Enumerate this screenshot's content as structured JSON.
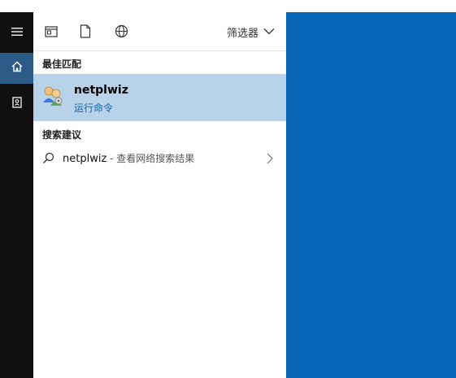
{
  "toolbar": {
    "filter_label": "筛选器",
    "icons": [
      "app-icon",
      "document-icon",
      "web-icon"
    ]
  },
  "rail": {
    "items": [
      {
        "icon": "menu-icon"
      },
      {
        "icon": "home-icon",
        "active": true
      },
      {
        "icon": "notebook-icon"
      }
    ]
  },
  "best_match": {
    "header": "最佳匹配",
    "title": "netplwiz",
    "subtitle": "运行命令",
    "icon": "users-icon"
  },
  "suggestions": {
    "header": "搜索建议",
    "items": [
      {
        "query": "netplwiz",
        "suffix": " - 查看网络搜索结果",
        "icon": "search-icon"
      }
    ]
  },
  "colors": {
    "desktop": "#0766b7",
    "rail": "#101010",
    "rail_active": "#2b5b86",
    "highlight": "#b7d2e9",
    "accent": "#1565b0"
  }
}
